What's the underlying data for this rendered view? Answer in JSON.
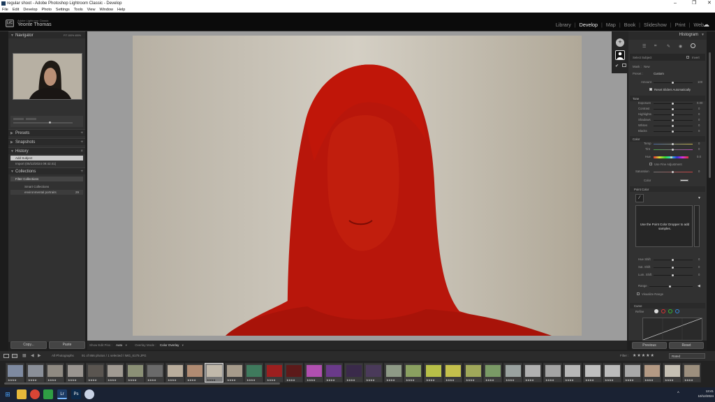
{
  "window": {
    "title": "regular shoot - Adobe Photoshop Lightroom Classic - Develop",
    "controls": [
      "–",
      "❐",
      "✕"
    ]
  },
  "menubar": [
    "File",
    "Edit",
    "Develop",
    "Photo",
    "Settings",
    "Tools",
    "View",
    "Window",
    "Help"
  ],
  "header": {
    "logo": "LrC",
    "app_name": "Adobe Lightroom Classic",
    "user_name": "Yeonte Thomas",
    "modules": [
      "Library",
      "Develop",
      "Map",
      "Book",
      "Slideshow",
      "Print",
      "Web"
    ],
    "active_module": "Develop"
  },
  "left_panel": {
    "navigator": {
      "title": "Navigator",
      "opts": "FIT  100%  400%"
    },
    "presets": {
      "title": "Presets"
    },
    "snapshots": {
      "title": "Snapshots"
    },
    "history": {
      "title": "History",
      "items": [
        "Add Subject",
        "Import (05/12/2024 09:42:41)"
      ]
    },
    "collections": {
      "title": "Collections",
      "items": [
        "Filter Collections",
        "Smart Collections",
        "environmental portraits"
      ],
      "count": "29"
    },
    "copy_label": "Copy...",
    "paste_label": "Paste"
  },
  "center_toolbar": {
    "show_edit_pins_label": "Show Edit Pins :",
    "show_edit_pins_value": "Auto",
    "overlay_mode_label": "Overlay Mode :",
    "overlay_mode_value": "Color Overlay"
  },
  "right_panel": {
    "histogram_title": "Histogram",
    "mask_label": "Select Subject",
    "invert_label": "Invert",
    "mask_name": "Mask :",
    "mask_new": "New",
    "preset_label": "Preset :",
    "preset_value": "Custom",
    "amount_label": "Amount",
    "amount_value": "100",
    "reset_sliders": "Reset Sliders Automatically",
    "tone": {
      "title": "Tone",
      "items": [
        {
          "label": "Exposure",
          "value": "0.00"
        },
        {
          "label": "Contrast",
          "value": "0"
        },
        {
          "label": "Highlights",
          "value": "0"
        },
        {
          "label": "Shadows",
          "value": "0"
        },
        {
          "label": "Whites",
          "value": "0"
        },
        {
          "label": "Blacks",
          "value": "0"
        }
      ]
    },
    "color": {
      "title": "Color",
      "items": [
        {
          "label": "Temp",
          "value": "0"
        },
        {
          "label": "Tint",
          "value": "0"
        },
        {
          "label": "Hue",
          "value": "0.0"
        }
      ],
      "fine_adjust": "Use Fine Adjustment",
      "saturation_label": "Saturation",
      "saturation_value": "0",
      "color_label": "Color"
    },
    "point_color": {
      "title": "Point Color",
      "hint": "Use the Point Color Dropper to add samples.",
      "items": [
        {
          "label": "Hue Shift",
          "value": "0"
        },
        {
          "label": "Sat. Shift",
          "value": "0"
        },
        {
          "label": "Lum. Shift",
          "value": "0"
        }
      ],
      "range_label": "Range",
      "visualize": "Visualize Range"
    },
    "curve": {
      "title": "Curve",
      "refine": "Refine"
    },
    "previous_label": "Previous",
    "reset_label": "Reset"
  },
  "filmstrip_bar": {
    "source": "All Photographs",
    "info": "91 of 866 photos / 1 selected / IMG_6179.JPG",
    "filter_label": "Filter :",
    "filter_value": "Rated"
  },
  "taskbar": {
    "time": "13:41",
    "date": "10/12/2024"
  },
  "colors": {
    "overlay": "#c0150a",
    "accent": "#f0f0f0"
  }
}
